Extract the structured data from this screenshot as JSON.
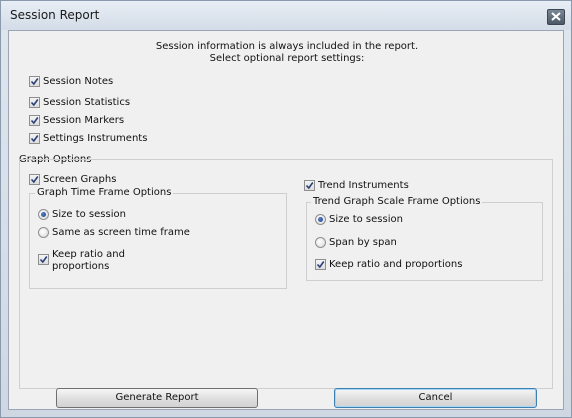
{
  "window": {
    "title": "Session Report"
  },
  "intro": {
    "line1": "Session information is always included in the report.",
    "line2": "Select optional report settings:"
  },
  "options": [
    {
      "label": "Session Notes",
      "checked": true
    },
    {
      "label": "Session Statistics",
      "checked": true
    },
    {
      "label": "Session Markers",
      "checked": true
    },
    {
      "label": "Settings Instruments",
      "checked": true
    }
  ],
  "graph_options": {
    "title": "Graph Options",
    "screen_graphs": {
      "label": "Screen Graphs",
      "checked": true
    },
    "time_frame": {
      "title": "Graph Time Frame Options",
      "radios": [
        {
          "label": "Size to session",
          "selected": true
        },
        {
          "label": "Same as screen time frame",
          "selected": false
        }
      ],
      "keep_ratio": {
        "label_line1": "Keep ratio and",
        "label_line2": "proportions",
        "checked": true
      }
    },
    "trend_instruments": {
      "label": "Trend Instruments",
      "checked": true
    },
    "scale_frame": {
      "title": "Trend Graph Scale Frame Options",
      "radios": [
        {
          "label": "Size to session",
          "selected": true
        },
        {
          "label": "Span by span",
          "selected": false
        }
      ],
      "keep_ratio": {
        "label": "Keep ratio and proportions",
        "checked": true
      }
    }
  },
  "buttons": {
    "generate": "Generate Report",
    "cancel": "Cancel"
  },
  "icons": {
    "close": "close-icon",
    "check": "checkmark-icon"
  }
}
